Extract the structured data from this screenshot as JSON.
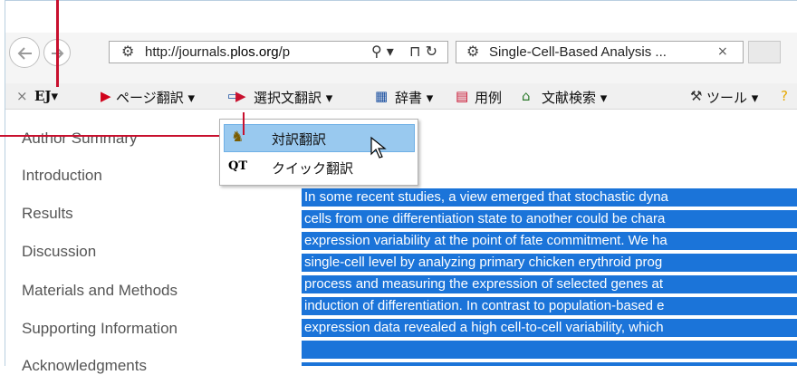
{
  "browser": {
    "url_prefix": "http://journals.",
    "url_domain": "plos.org",
    "url_suffix": "/p",
    "tab_title": "Single-Cell-Based Analysis ...",
    "tab_close": "×",
    "search_glyph": "⚲ ▾",
    "page_icons": "⊓ ↻"
  },
  "toolbar": {
    "close": "×",
    "ej": "EJ▾",
    "page_translate": "ページ翻訳 ▾",
    "selection_translate": "選択文翻訳 ▾",
    "dictionary": "辞書  ▾",
    "examples": "用例",
    "literature_search": "文献検索 ▾",
    "tools": "ツール ▾"
  },
  "menu": {
    "items": [
      {
        "label": "対訳翻訳",
        "icon": "parallel-translation-icon"
      },
      {
        "label": "クイック翻訳",
        "icon": "quick-translation-icon"
      }
    ]
  },
  "sidebar": {
    "items": [
      "Author Summary",
      "Introduction",
      "Results",
      "Discussion",
      "Materials and Methods",
      "Supporting Information",
      "Acknowledgments"
    ]
  },
  "content": {
    "lines": [
      "In some recent studies, a view emerged that stochastic dyna",
      "cells from one differentiation state to another could be chara",
      "expression variability at the point of fate commitment. We ha",
      "single-cell level by analyzing primary chicken erythroid prog",
      "process and measuring the expression of selected genes at",
      "induction of differentiation. In contrast to population-based e",
      "expression data revealed a high cell-to-cell variability, which"
    ]
  }
}
